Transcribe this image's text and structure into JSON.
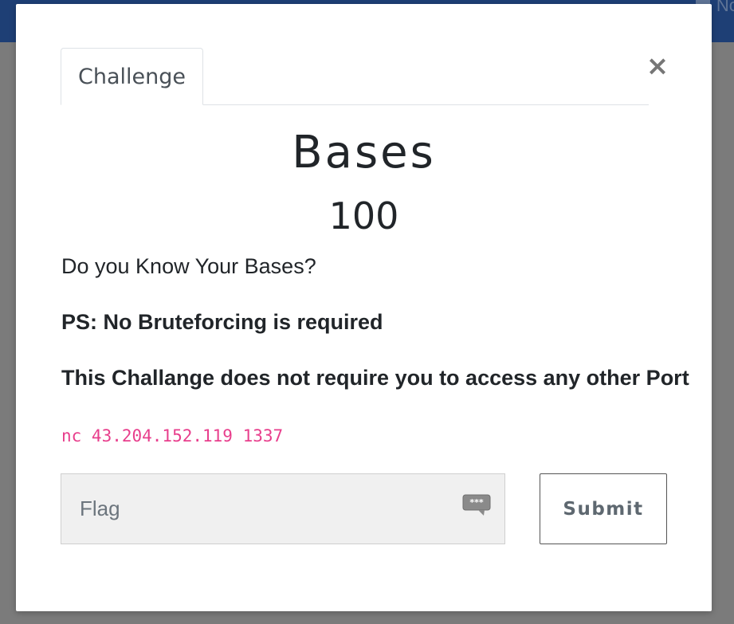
{
  "backdrop": {
    "navbar_color": "#1e3f75",
    "overlay_color": "#7b7b7b",
    "nav_fragment_text": "No"
  },
  "modal": {
    "tab_label": "Challenge",
    "close_symbol": "×",
    "challenge_name": "Bases",
    "points": "100",
    "description": {
      "question": "Do you Know Your Bases?",
      "note_bruteforce": "PS: No Bruteforcing is required",
      "note_port": "This Challange does not require you to access any other Port"
    },
    "connection_command": "nc 43.204.152.119 1337",
    "flag_input": {
      "placeholder": "Flag",
      "value": "",
      "icon": "password-bubble-icon"
    },
    "submit_label": "Submit"
  },
  "colors": {
    "code_text": "#e83e8c",
    "text_dark": "#212529",
    "input_bg": "#f0f0f0"
  }
}
